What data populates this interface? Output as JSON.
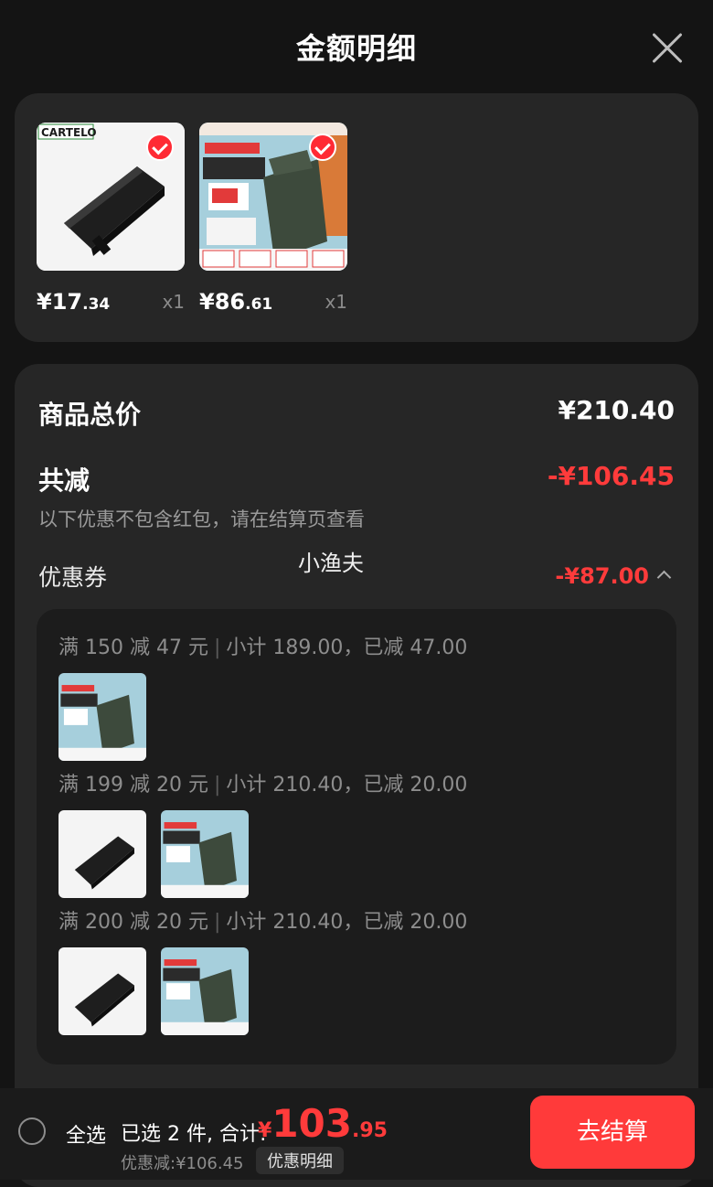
{
  "header": {
    "title": "金额明细",
    "close_icon": "close-icon"
  },
  "products": [
    {
      "price_int": "¥17",
      "price_dec": ".34",
      "qty": "x1",
      "brand_text": "CARTELO"
    },
    {
      "price_int": "¥86",
      "price_dec": ".61",
      "qty": "x1"
    }
  ],
  "summary": {
    "goods_total_label": "商品总价",
    "goods_total_value": "¥210.40",
    "discount_label": "共减",
    "discount_value": "-¥106.45",
    "note": "以下优惠不包含红包，请在结算页查看",
    "coupon_label": "优惠券",
    "coupon_value": "-¥87.00",
    "watermark": "小渔夫"
  },
  "coupons": [
    {
      "rule": "满 150 减 47 元",
      "detail": "小计 189.00，已减 47.00"
    },
    {
      "rule": "满 199 减 20 元",
      "detail": "小计 210.40，已减 20.00"
    },
    {
      "rule": "满 200 减 20 元",
      "detail": "小计 210.40，已减 20.00"
    }
  ],
  "bottom": {
    "select_all": "全选",
    "selected_text": "已选 2 件, 合计:",
    "total_cur": "¥",
    "total_int": "103",
    "total_dec": ".95",
    "savings": "优惠减:¥106.45",
    "detail_button": "优惠明细",
    "checkout_button": "去结算"
  },
  "colors": {
    "accent_red": "#ff3b3b",
    "checkout_bg": "#ff3a3a",
    "card_bg": "#262626"
  }
}
